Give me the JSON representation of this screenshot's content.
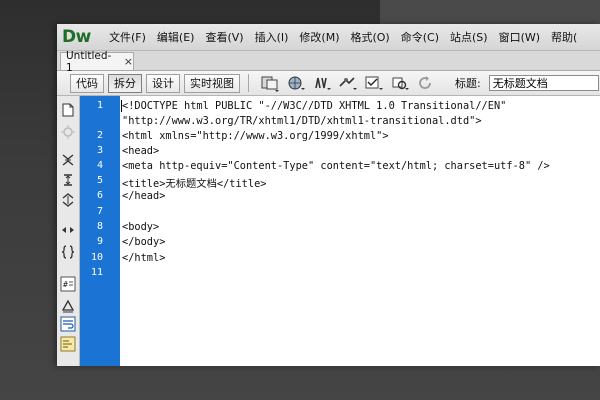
{
  "app": {
    "logo": "Dw",
    "menu": [
      "文件(F)",
      "编辑(E)",
      "查看(V)",
      "插入(I)",
      "修改(M)",
      "格式(O)",
      "命令(C)",
      "站点(S)",
      "窗口(W)",
      "帮助("
    ]
  },
  "document_tab": {
    "label": "Untitled-1",
    "close": "×"
  },
  "toolbar": {
    "view_buttons": [
      "代码",
      "拆分",
      "设计",
      "实时视图"
    ],
    "active_view": "拆分",
    "title_label": "标题:",
    "title_value": "无标题文档",
    "icons": [
      "file-management-icon",
      "preview-globe-icon",
      "debug-icon",
      "visual-aids-icon",
      "validate-markup-icon",
      "check-compat-icon",
      "refresh-icon"
    ]
  },
  "coding_toolbar": {
    "icons": [
      "open-documents-icon",
      "collapse-tag-icon",
      "collapse-selection-icon",
      "expand-all-icon",
      "select-parent-icon",
      "balance-braces-icon",
      "line-numbers-icon",
      "highlight-invalid-icon",
      "word-wrap-icon",
      "syntax-coloring-icon"
    ]
  },
  "code": {
    "line_numbers": [
      "1",
      "2",
      "3",
      "4",
      "5",
      "6",
      "7",
      "8",
      "9",
      "10",
      "11"
    ],
    "lines": [
      "<!DOCTYPE html PUBLIC \"-//W3C//DTD XHTML 1.0 Transitional//EN\"",
      "\"http://www.w3.org/TR/xhtml1/DTD/xhtml1-transitional.dtd\">",
      "<html xmlns=\"http://www.w3.org/1999/xhtml\">",
      "<head>",
      "<meta http-equiv=\"Content-Type\" content=\"text/html; charset=utf-8\" />",
      "<title>无标题文档</title>",
      "</head>",
      "",
      "<body>",
      "</body>",
      "</html>",
      ""
    ]
  },
  "colors": {
    "gutter": "#1b73d4",
    "logo": "#1f6e28"
  }
}
